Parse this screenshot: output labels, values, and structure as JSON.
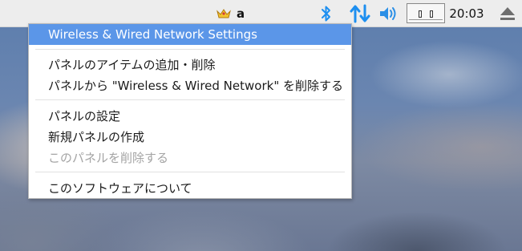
{
  "panel": {
    "tray": {
      "crown_icon": "crown-icon",
      "keyboard_layout": "a",
      "bluetooth_icon": "bluetooth-icon",
      "network_icon": "network-updown-icon",
      "volume_icon": "volume-icon",
      "cpu_monitor_icon": "cpu-monitor-icon",
      "eject_icon": "eject-icon"
    },
    "clock": "20:03"
  },
  "context_menu": {
    "items": [
      {
        "label": "Wireless & Wired Network Settings",
        "state": "highlighted"
      },
      {
        "label": "パネルのアイテムの追加・削除",
        "state": "normal"
      },
      {
        "label": "パネルから \"Wireless & Wired Network\" を削除する",
        "state": "normal"
      },
      {
        "label": "パネルの設定",
        "state": "normal"
      },
      {
        "label": "新規パネルの作成",
        "state": "normal"
      },
      {
        "label": "このパネルを削除する",
        "state": "disabled"
      },
      {
        "label": "このソフトウェアについて",
        "state": "normal"
      }
    ]
  },
  "colors": {
    "highlight": "#5b96e8",
    "bluetooth": "#1d8ff0",
    "network": "#1d8ff0",
    "volume": "#2b8fe6",
    "panel_bg": "#ededed",
    "disabled_text": "#a4a4a4"
  }
}
